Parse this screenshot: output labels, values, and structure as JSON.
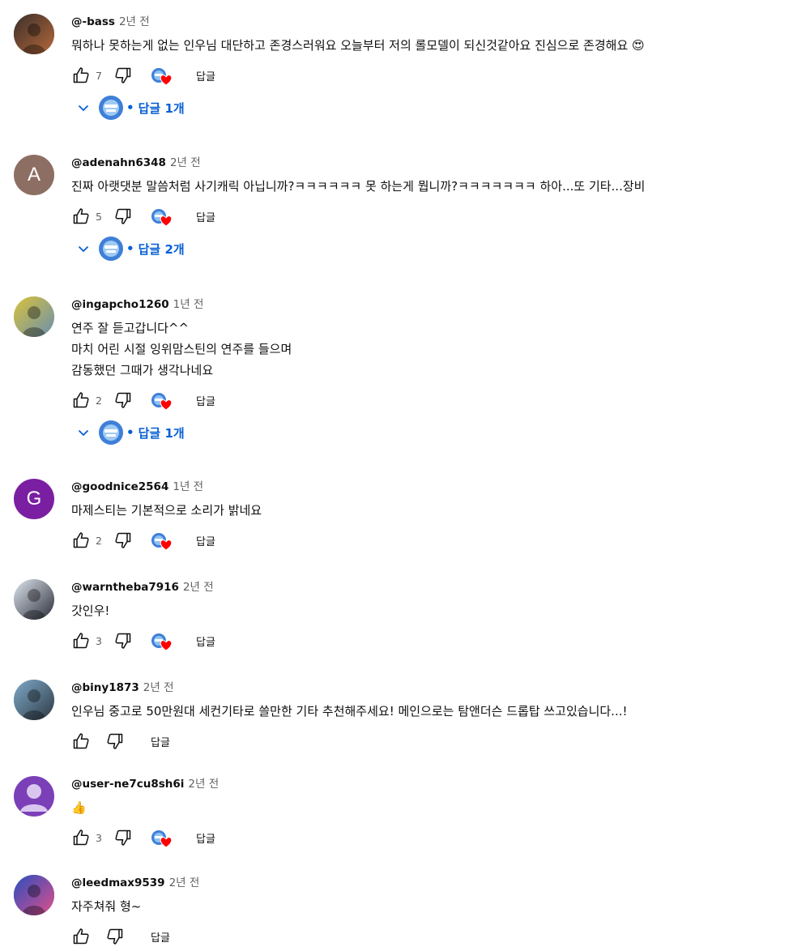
{
  "reply_label": "답글",
  "replies_prefix": "답글",
  "comments": [
    {
      "author": "@-bass",
      "time": "2년 전",
      "text": "뭐하나 못하는게 없는 인우님 대단하고 존경스러워요 오늘부터 저의 롤모델이 되신것같아요 진심으로 존경해요 😍",
      "likes": "7",
      "creator_heart": true,
      "replies": "1개",
      "avatar": {
        "type": "photo",
        "colors": [
          "#3a2f2b",
          "#b5683a"
        ]
      }
    },
    {
      "author": "@adenahn6348",
      "time": "2년 전",
      "text": "진짜 아랫댓분 말씀처럼 사기캐릭 아닙니까?ㅋㅋㅋㅋㅋㅋ 못 하는게 뭡니까?ㅋㅋㅋㅋㅋㅋㅋ 하아...또 기타...장비",
      "likes": "5",
      "creator_heart": true,
      "replies": "2개",
      "avatar": {
        "type": "letter",
        "letter": "A",
        "color": "#8d6e63"
      }
    },
    {
      "author": "@ingapcho1260",
      "time": "1년 전",
      "text": "연주 잘 듣고갑니다^^\n마치 어린 시절 잉위맘스틴의 연주를 들으며\n감동했던 그때가 생각나네요",
      "likes": "2",
      "creator_heart": true,
      "replies": "1개",
      "avatar": {
        "type": "photo",
        "colors": [
          "#d8c23a",
          "#6a8fb0"
        ]
      }
    },
    {
      "author": "@goodnice2564",
      "time": "1년 전",
      "text": "마제스티는 기본적으로 소리가 밝네요",
      "likes": "2",
      "creator_heart": true,
      "replies": "",
      "avatar": {
        "type": "letter",
        "letter": "G",
        "color": "#7b1fa2"
      }
    },
    {
      "author": "@warntheba7916",
      "time": "2년 전",
      "text": "갓인우!",
      "likes": "3",
      "creator_heart": true,
      "replies": "",
      "avatar": {
        "type": "photo",
        "colors": [
          "#dfe6ee",
          "#2b2f3a"
        ]
      }
    },
    {
      "author": "@biny1873",
      "time": "2년 전",
      "text": "인우님 중고로 50만원대 세컨기타로 쓸만한 기타 추천해주세요! 메인으로는 탐앤더슨 드롭탑 쓰고있습니다...!",
      "likes": "",
      "creator_heart": false,
      "replies": "",
      "avatar": {
        "type": "photo",
        "colors": [
          "#7fa9c9",
          "#2e3a44"
        ]
      }
    },
    {
      "author": "@user-ne7cu8sh6i",
      "time": "2년 전",
      "text": "👍",
      "likes": "3",
      "creator_heart": true,
      "replies": "",
      "avatar": {
        "type": "default",
        "color": "#7b3fb8"
      }
    },
    {
      "author": "@leedmax9539",
      "time": "2년 전",
      "text": "자주쳐줘 형~",
      "likes": "",
      "creator_heart": false,
      "replies": "",
      "avatar": {
        "type": "photo",
        "colors": [
          "#2a4dbf",
          "#e0508a"
        ]
      }
    }
  ]
}
